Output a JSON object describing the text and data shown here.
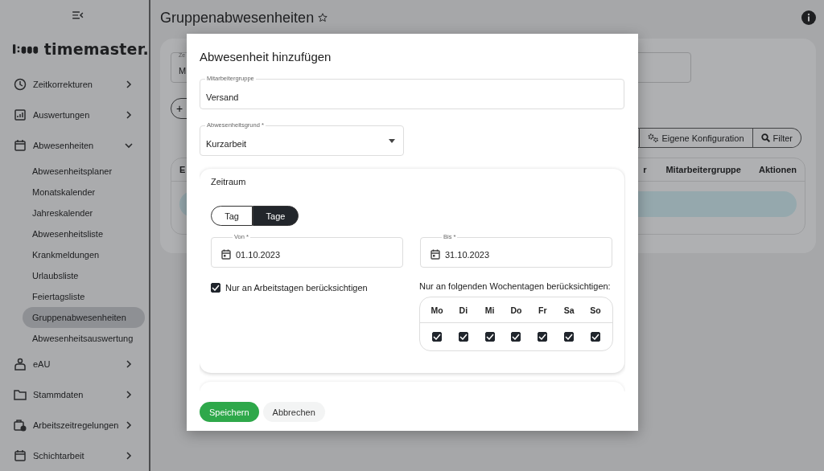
{
  "sidebar": {
    "logo": "timemaster.",
    "items": [
      {
        "label": "Zeitkorrekturen",
        "expanded": false
      },
      {
        "label": "Auswertungen",
        "expanded": false
      },
      {
        "label": "Abwesenheiten",
        "expanded": true,
        "children": [
          {
            "label": "Abwesenheitsplaner",
            "selected": false
          },
          {
            "label": "Monatskalender",
            "selected": false
          },
          {
            "label": "Jahreskalender",
            "selected": false
          },
          {
            "label": "Abwesenheitsliste",
            "selected": false
          },
          {
            "label": "Krankmeldungen",
            "selected": false
          },
          {
            "label": "Urlaubsliste",
            "selected": false
          },
          {
            "label": "Feiertagsliste",
            "selected": false
          },
          {
            "label": "Gruppenabwesenheiten",
            "selected": true
          },
          {
            "label": "Abwesenheitsauswertung",
            "selected": false
          }
        ]
      },
      {
        "label": "eAU",
        "expanded": false
      },
      {
        "label": "Stammdaten",
        "expanded": false
      },
      {
        "label": "Arbeitszeitregelungen",
        "expanded": false
      },
      {
        "label": "Schichtarbeit",
        "expanded": false
      }
    ]
  },
  "page": {
    "title": "Gruppenabwesenheiten",
    "field_label": "Ze",
    "field_value": "M",
    "add_button": "+",
    "toolbar": [
      "Eigene Konfiguration",
      "Filter"
    ],
    "table": {
      "columns": [
        "E",
        "r",
        "Mitarbeitergruppe",
        "Aktionen"
      ]
    }
  },
  "dialog": {
    "title": "Abwesenheit hinzufügen",
    "group_field": {
      "label": "Mitarbeitergruppe",
      "value": "Versand"
    },
    "reason_field": {
      "label": "Abwesenheitsgrund *",
      "value": "Kurzarbeit"
    },
    "period": {
      "title": "Zeitraum",
      "modes": [
        {
          "label": "Tag",
          "selected": false
        },
        {
          "label": "Tage",
          "selected": true
        }
      ],
      "from": {
        "label": "Von *",
        "value": "01.10.2023"
      },
      "to": {
        "label": "Bis *",
        "value": "31.10.2023"
      },
      "workdays_only": {
        "label": "Nur an Arbeitstagen berücksichtigen",
        "checked": true
      },
      "weekdays_label": "Nur an folgenden Wochentagen berücksichtigen:",
      "weekdays": [
        {
          "label": "Mo",
          "checked": true
        },
        {
          "label": "Di",
          "checked": true
        },
        {
          "label": "Mi",
          "checked": true
        },
        {
          "label": "Do",
          "checked": true
        },
        {
          "label": "Fr",
          "checked": true
        },
        {
          "label": "Sa",
          "checked": true
        },
        {
          "label": "So",
          "checked": true
        }
      ]
    },
    "buttons": [
      {
        "label": "Speichern",
        "kind": "primary"
      },
      {
        "label": "Abbrechen",
        "kind": "secondary"
      }
    ]
  }
}
